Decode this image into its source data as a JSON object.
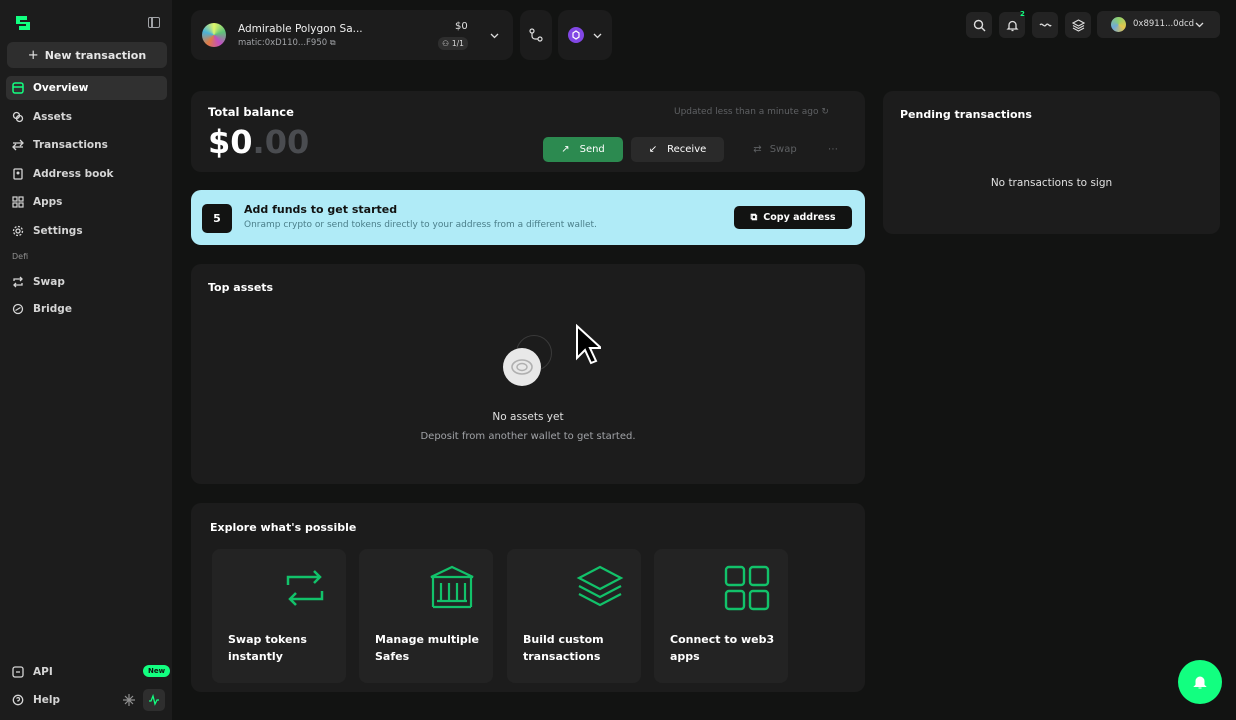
{
  "sidebar": {
    "new_transaction": "New transaction",
    "items": [
      {
        "label": "Overview",
        "icon": "home-icon",
        "active": true
      },
      {
        "label": "Assets",
        "icon": "coins-icon"
      },
      {
        "label": "Transactions",
        "icon": "transactions-icon"
      },
      {
        "label": "Address book",
        "icon": "address-book-icon"
      },
      {
        "label": "Apps",
        "icon": "apps-icon"
      },
      {
        "label": "Settings",
        "icon": "gear-icon"
      }
    ],
    "section_label": "Defi",
    "defi_items": [
      {
        "label": "Swap",
        "icon": "swap-icon"
      },
      {
        "label": "Bridge",
        "icon": "bridge-icon"
      }
    ],
    "footer": {
      "api_label": "API",
      "api_badge": "New",
      "help_label": "Help"
    }
  },
  "header": {
    "safe_name": "Admirable Polygon Sa...",
    "safe_address": "matic:0xD110...F950",
    "safe_balance": "$0",
    "threshold": "1/1",
    "notification_count": "2",
    "wallet_address": "0x8911...0dcd"
  },
  "balance": {
    "label": "Total balance",
    "value_whole": "$0",
    "value_decimal": ".00",
    "updated": "Updated less than a minute ago",
    "send": "Send",
    "receive": "Receive",
    "swap": "Swap"
  },
  "banner": {
    "step": "5",
    "title": "Add funds to get started",
    "subtitle": "Onramp crypto or send tokens directly to your address from a different wallet.",
    "copy_button": "Copy address"
  },
  "top_assets": {
    "title": "Top assets",
    "empty_title": "No assets yet",
    "empty_subtitle": "Deposit from another wallet to get started."
  },
  "explore": {
    "title": "Explore what's possible",
    "features": [
      {
        "label": "Swap tokens instantly",
        "icon": "swap-arrows-icon"
      },
      {
        "label": "Manage multiple Safes",
        "icon": "bank-icon"
      },
      {
        "label": "Build custom transactions",
        "icon": "layers-icon"
      },
      {
        "label": "Connect to web3 apps",
        "icon": "grid-icon"
      }
    ]
  },
  "pending": {
    "title": "Pending transactions",
    "empty": "No transactions to sign"
  },
  "colors": {
    "accent": "#12ff80",
    "banner": "#b0ebf7",
    "card": "#1c1c1c",
    "background": "#121312"
  }
}
